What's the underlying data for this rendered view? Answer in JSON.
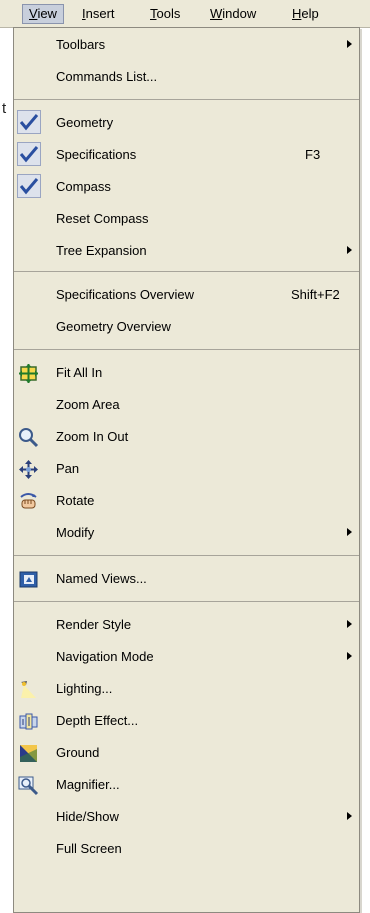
{
  "menubar": {
    "items": [
      "View",
      "Insert",
      "Tools",
      "Window",
      "Help"
    ],
    "active": "View"
  },
  "background": {
    "fragment_text": "t"
  },
  "menu": {
    "toolbars": "Toolbars",
    "commands_list": "Commands List...",
    "geometry": "Geometry",
    "specifications": "Specifications",
    "specifications_shortcut": "F3",
    "compass": "Compass",
    "reset_compass": "Reset Compass",
    "tree_expansion": "Tree Expansion",
    "specifications_overview": "Specifications Overview",
    "specifications_overview_shortcut": "Shift+F2",
    "geometry_overview": "Geometry Overview",
    "fit_all_in": "Fit All In",
    "zoom_area": "Zoom Area",
    "zoom_in_out": "Zoom In Out",
    "pan": "Pan",
    "rotate": "Rotate",
    "modify": "Modify",
    "named_views": "Named Views...",
    "render_style": "Render Style",
    "navigation_mode": "Navigation Mode",
    "lighting": "Lighting...",
    "depth_effect": "Depth Effect...",
    "ground": "Ground",
    "magnifier": "Magnifier...",
    "hide_show": "Hide/Show",
    "full_screen": "Full Screen"
  },
  "checked": [
    "geometry",
    "specifications",
    "compass"
  ],
  "icons": {
    "check": "checkmark-icon",
    "fit_all_in": "fit-all-in-icon",
    "zoom_in_out": "magnifying-glass-icon",
    "pan": "pan-arrows-icon",
    "rotate": "rotate-hand-icon",
    "named_views": "named-views-icon",
    "lighting": "lamp-icon",
    "depth_effect": "depth-effect-icon",
    "ground": "ground-icon",
    "magnifier": "magnifier-icon"
  },
  "colors": {
    "menu_bg": "#ece9d8",
    "check_bg": "#dde2ec",
    "check_mark": "#2a4fa0"
  }
}
